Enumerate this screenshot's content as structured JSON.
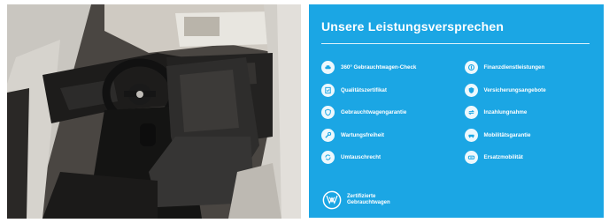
{
  "promise_panel": {
    "title": "Unsere Leistungsversprechen",
    "background_color": "#1ba6e4",
    "features": [
      {
        "label": "360° Gebrauchtwagen-Check",
        "icon": "car-check-icon"
      },
      {
        "label": "Finanzdienstleistungen",
        "icon": "finance-icon"
      },
      {
        "label": "Qualitätszertifikat",
        "icon": "certificate-icon"
      },
      {
        "label": "Versicherungsangebote",
        "icon": "insurance-icon"
      },
      {
        "label": "Gebrauchtwagengarantie",
        "icon": "shield-icon"
      },
      {
        "label": "Inzahlungnahme",
        "icon": "trade-in-icon"
      },
      {
        "label": "Wartungsfreiheit",
        "icon": "wrench-icon"
      },
      {
        "label": "Mobilitätsgarantie",
        "icon": "mobility-car-icon"
      },
      {
        "label": "Umtauschrecht",
        "icon": "exchange-icon"
      },
      {
        "label": "Ersatzmobilität",
        "icon": "replacement-car-icon"
      }
    ],
    "brand": {
      "logo": "vw-logo",
      "line1": "Zertifizierte",
      "line2": "Gebrauchtwagen"
    }
  },
  "photo": {
    "subject": "car-interior-photo"
  }
}
